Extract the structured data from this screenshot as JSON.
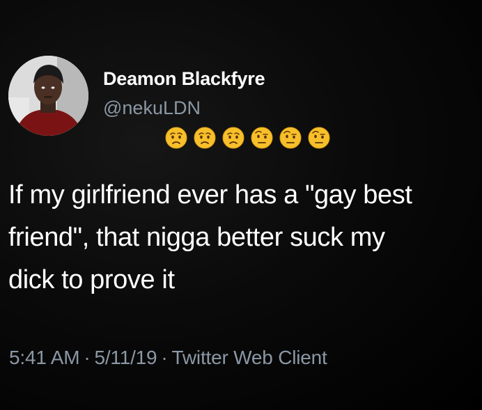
{
  "tweet": {
    "display_name": "Deamon Blackfyre",
    "handle": "@nekuLDN",
    "emojis": [
      {
        "icon": "worried-face-icon"
      },
      {
        "icon": "worried-face-icon"
      },
      {
        "icon": "worried-face-icon"
      },
      {
        "icon": "raised-eyebrow-face-icon"
      },
      {
        "icon": "raised-eyebrow-face-icon"
      },
      {
        "icon": "raised-eyebrow-face-icon"
      }
    ],
    "text": "If my girlfriend ever has a \"gay best\nfriend\", that nigga better suck my\ndick to prove it",
    "time": "5:41 AM",
    "date": "5/11/19",
    "client": "Twitter Web Client",
    "separator": "·"
  },
  "colors": {
    "background": "#000000",
    "text": "#ffffff",
    "secondary": "#8b98a5",
    "emoji": "#f7c02b"
  }
}
